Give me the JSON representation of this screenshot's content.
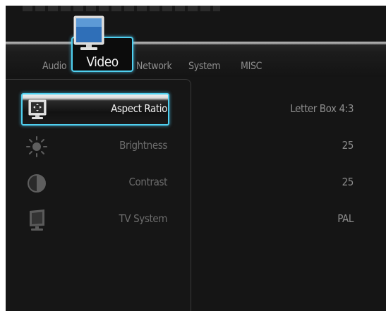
{
  "tabs": [
    {
      "label": "Audio"
    },
    {
      "label": "Video"
    },
    {
      "label": "Network"
    },
    {
      "label": "System"
    },
    {
      "label": "MISC"
    }
  ],
  "active_tab": "Video",
  "settings": [
    {
      "label": "Aspect Ratio",
      "value": "Letter Box 4:3",
      "icon": "aspect-ratio-icon",
      "selected": true
    },
    {
      "label": "Brightness",
      "value": "25",
      "icon": "brightness-icon",
      "selected": false
    },
    {
      "label": "Contrast",
      "value": "25",
      "icon": "contrast-icon",
      "selected": false
    },
    {
      "label": "TV System",
      "value": "PAL",
      "icon": "tv-system-icon",
      "selected": false
    }
  ],
  "colors": {
    "accent": "#4fd0f0",
    "background": "#151515",
    "text_active": "#f0f0f0",
    "text_inactive": "#8d8d8d"
  }
}
